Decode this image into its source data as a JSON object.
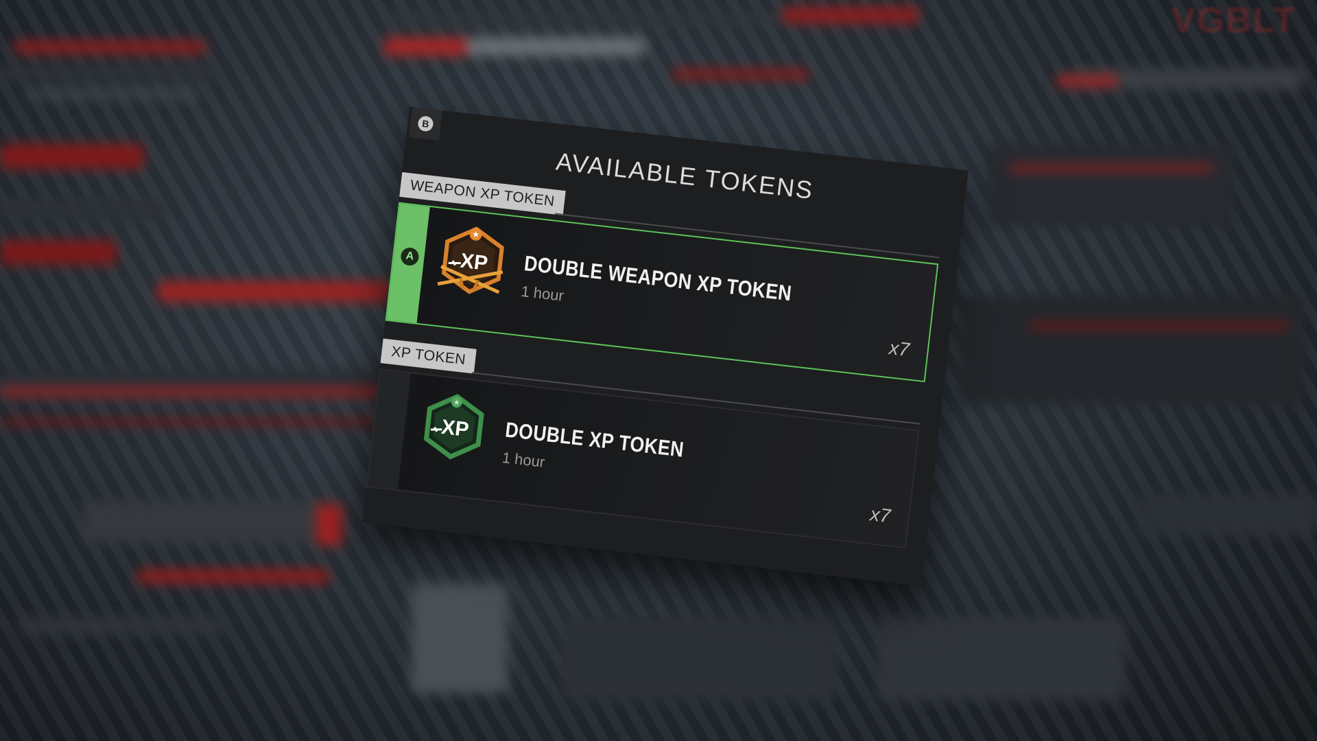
{
  "colors": {
    "accent_green": "#6cc067",
    "weapon_badge_orange": "#d9822b",
    "xp_badge_green": "#3f8f4a"
  },
  "overlay": {
    "title": "AVAILABLE TOKENS",
    "back_button_glyph": "B",
    "back_icon": "b-button-icon",
    "watermark": "VGBLT"
  },
  "sections": [
    {
      "label": "WEAPON XP TOKEN",
      "card": {
        "name": "DOUBLE WEAPON XP TOKEN",
        "duration": "1 hour",
        "quantity": "x7",
        "icon": "double-weapon-xp-icon",
        "badge_text": "XP",
        "selected": true,
        "select_glyph": "A"
      }
    },
    {
      "label": "XP TOKEN",
      "card": {
        "name": "DOUBLE XP TOKEN",
        "duration": "1 hour",
        "quantity": "x7",
        "icon": "double-xp-icon",
        "badge_text": "XP",
        "selected": false
      }
    }
  ]
}
